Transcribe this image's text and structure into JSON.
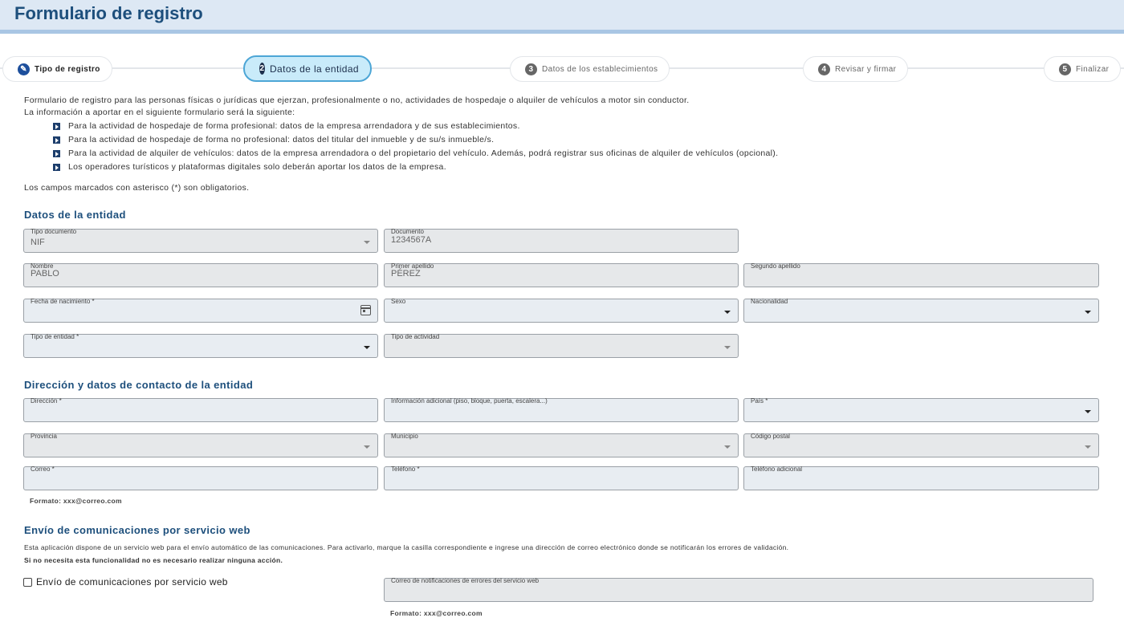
{
  "header": {
    "title": "Formulario de registro"
  },
  "stepper": {
    "steps": [
      {
        "num": "",
        "label": "Tipo de registro",
        "state": "done"
      },
      {
        "num": "2",
        "label": "Datos de la entidad",
        "state": "active"
      },
      {
        "num": "3",
        "label": "Datos de los establecimientos",
        "state": "pending"
      },
      {
        "num": "4",
        "label": "Revisar y firmar",
        "state": "pending"
      },
      {
        "num": "5",
        "label": "Finalizar",
        "state": "pending"
      }
    ]
  },
  "intro": {
    "line1": "Formulario de registro para las personas físicas o jurídicas que ejerzan, profesionalmente o no, actividades de hospedaje o alquiler de vehículos a motor sin conductor.",
    "line2": "La información a aportar en el siguiente formulario será la siguiente:",
    "bullets": [
      "Para la actividad de hospedaje de forma profesional: datos de la empresa arrendadora y de sus establecimientos.",
      "Para la actividad de hospedaje de forma no profesional: datos del titular del inmueble y de su/s inmueble/s.",
      "Para la actividad de alquiler de vehículos: datos de la empresa arrendadora o del propietario del vehículo. Además, podrá registrar sus oficinas de alquiler de vehículos (opcional).",
      "Los operadores turísticos y plataformas digitales solo deberán aportar los datos de la empresa."
    ],
    "required_note": "Los campos marcados con asterisco (*) son obligatorios."
  },
  "entity": {
    "title": "Datos de la entidad",
    "tipo_documento": {
      "label": "Tipo documento",
      "value": "NIF"
    },
    "documento": {
      "label": "Documento",
      "value": "1234567A"
    },
    "nombre": {
      "label": "Nombre",
      "value": "PABLO"
    },
    "primer_apellido": {
      "label": "Primer apellido",
      "value": "PÉREZ"
    },
    "segundo_apellido": {
      "label": "Segundo apellido",
      "value": ""
    },
    "fecha_nacimiento": {
      "label": "Fecha de nacimiento *",
      "value": ""
    },
    "sexo": {
      "label": "Sexo",
      "value": ""
    },
    "nacionalidad": {
      "label": "Nacionalidad",
      "value": ""
    },
    "tipo_entidad": {
      "label": "Tipo de entidad *",
      "value": ""
    },
    "tipo_actividad": {
      "label": "Tipo de actividad",
      "value": ""
    }
  },
  "contact": {
    "title": "Dirección y datos de contacto de la entidad",
    "direccion": {
      "label": "Dirección *"
    },
    "info_adicional": {
      "label": "Información adicional (piso, bloque, puerta, escalera...)"
    },
    "pais": {
      "label": "País *"
    },
    "provincia": {
      "label": "Provincia"
    },
    "municipio": {
      "label": "Municipio"
    },
    "codigo_postal": {
      "label": "Código postal"
    },
    "correo": {
      "label": "Correo *"
    },
    "telefono": {
      "label": "Teléfono *"
    },
    "telefono_adicional": {
      "label": "Teléfono adicional"
    },
    "correo_hint": "Formato: xxx@correo.com"
  },
  "webservice": {
    "title": "Envío de comunicaciones por servicio web",
    "description": "Esta aplicación dispone de un servicio web para el envío automático de las comunicaciones. Para activarlo, marque la casilla correspondiente e ingrese una dirección de correo electrónico donde se notificarán los errores de validación.",
    "note": "Si no necesita esta funcionalidad no es necesario realizar ninguna acción.",
    "checkbox_label": "Envío de comunicaciones por servicio web",
    "error_email": {
      "label": "Correo de notificaciones de errores del servicio web"
    },
    "hint": "Formato: xxx@correo.com"
  }
}
